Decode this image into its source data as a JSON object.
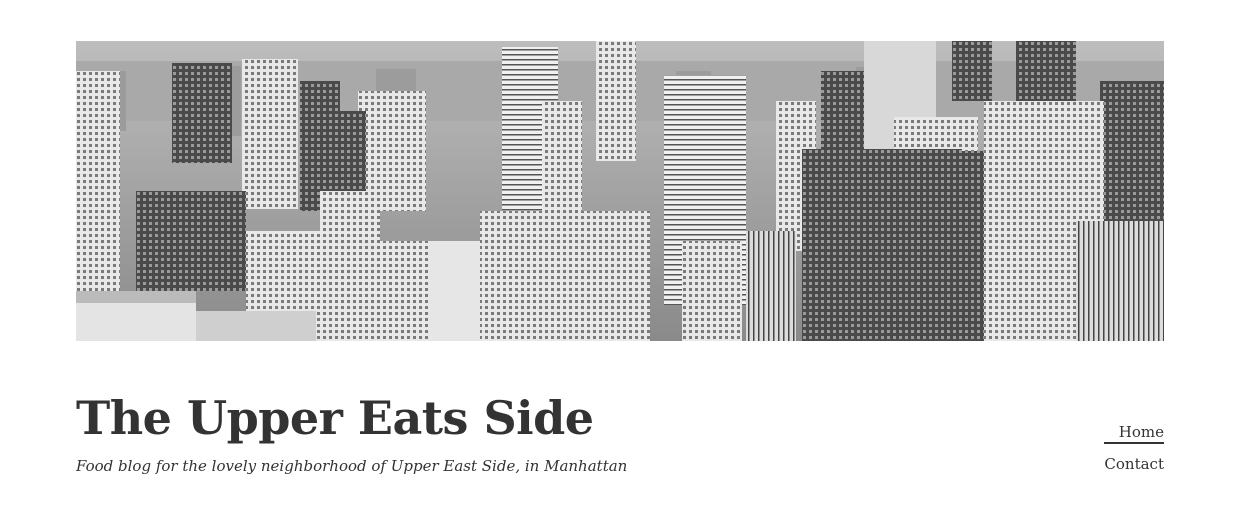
{
  "site": {
    "title": "The Upper Eats Side",
    "tagline": "Food blog for the lovely neighborhood of Upper East Side, in Manhattan"
  },
  "nav": {
    "items": [
      {
        "label": "Home",
        "active": true
      },
      {
        "label": "Contact",
        "active": false
      }
    ]
  },
  "hero": {
    "image": "black-and-white aerial photograph of Manhattan skyscrapers"
  },
  "colors": {
    "text": "#333333",
    "background": "#ffffff"
  }
}
